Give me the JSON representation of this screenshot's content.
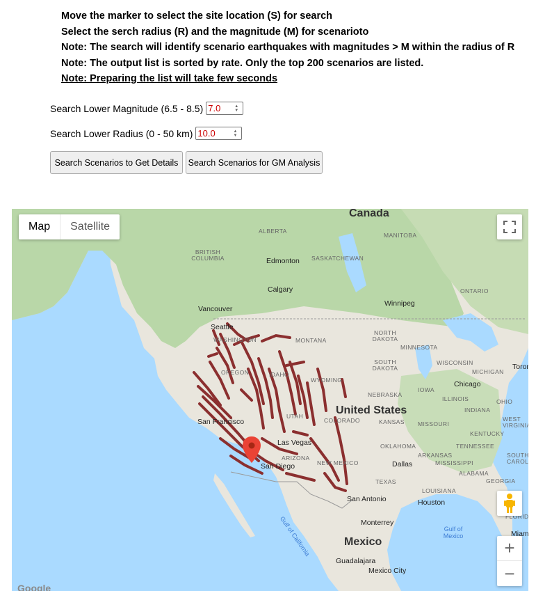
{
  "instructions": [
    "Move the marker to select the site location (S) for search",
    "Select the serch radius (R) and the magnitude (M) for scenarioto",
    "Note: The search will identify scenario earthquakes with magnitudes > M within the radius of R",
    "Note: The output list is sorted by rate. Only the top 200 scenarios are listed.",
    "Note: Preparing the list will take few seconds"
  ],
  "magnitude": {
    "label": "Search Lower Magnitude (6.5 - 8.5)",
    "value": "7.0"
  },
  "radius": {
    "label": "Search Lower Radius (0 - 50 km)",
    "value": "10.0"
  },
  "buttons": {
    "details": "Search Scenarios to Get Details",
    "gm": "Search Scenarios for GM Analysis"
  },
  "map": {
    "type_control": {
      "map": "Map",
      "satellite": "Satellite",
      "selected": "Map"
    },
    "zoom_in": "+",
    "zoom_out": "−",
    "fullscreen_icon": "fullscreen-icon",
    "pegman_icon": "street-view-pegman-icon",
    "marker_icon": "map-pin-icon",
    "colors": {
      "land": "#e9e6dd",
      "forest": "#b9d7a8",
      "water": "#aadaff",
      "faults": "#8b2f2f",
      "marker": "#ea4335"
    },
    "labels": {
      "countries": [
        "Canada",
        "United States",
        "Mexico"
      ],
      "cities": [
        "Edmonton",
        "Calgary",
        "Vancouver",
        "Seattle",
        "Winnipeg",
        "San Francisco",
        "Las Vegas",
        "San Diego",
        "Chicago",
        "Dallas",
        "San Antonio",
        "Houston",
        "Monterrey",
        "Guadalajara",
        "Mexico City",
        "Toronto",
        "Miami"
      ],
      "states": [
        "ALBERTA",
        "MANITOBA",
        "BRITISH COLUMBIA",
        "SASKATCHEWAN",
        "ONTARIO",
        "WASHINGTON",
        "MONTANA",
        "NORTH DAKOTA",
        "MINNESOTA",
        "SOUTH DAKOTA",
        "WISCONSIN",
        "MICHIGAN",
        "OREGON",
        "IDAHO",
        "WYOMING",
        "NEBRASKA",
        "IOWA",
        "ILLINOIS",
        "OHIO",
        "INDIANA",
        "UTAH",
        "COLORADO",
        "KANSAS",
        "MISSOURI",
        "KENTUCKY",
        "WEST VIRGINIA",
        "OKLAHOMA",
        "TENNESSEE",
        "ARIZONA",
        "NEW MEXICO",
        "ARKANSAS",
        "MISSISSIPPI",
        "ALABAMA",
        "GEORGIA",
        "SOUTH CAROLINA",
        "TEXAS",
        "LOUISIANA",
        "FLORIDA"
      ],
      "waters": [
        "Gulf of California",
        "Gulf of Mexico"
      ]
    },
    "logo": "Google"
  }
}
